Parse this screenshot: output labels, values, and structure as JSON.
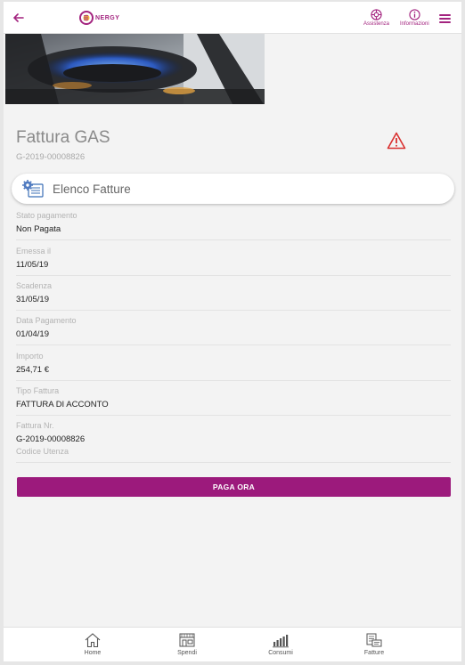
{
  "header": {
    "logo_text": "NERGY",
    "assistenza_label": "Assistenza",
    "informazioni_label": "Informazioni"
  },
  "invoice": {
    "title": "Fattura GAS",
    "code": "G-2019-00008826"
  },
  "elenco": {
    "label": "Elenco Fatture"
  },
  "fields": [
    {
      "label": "Stato pagamento",
      "value": "Non Pagata"
    },
    {
      "label": "Emessa il",
      "value": "11/05/19"
    },
    {
      "label": "Scadenza",
      "value": "31/05/19"
    },
    {
      "label": "Data Pagamento",
      "value": "01/04/19"
    },
    {
      "label": "Importo",
      "value": "254,71 €"
    },
    {
      "label": "Tipo Fattura",
      "value": "FATTURA DI ACCONTO"
    },
    {
      "label": "Fattura Nr.",
      "value": "G-2019-00008826"
    },
    {
      "label": "Codice Utenza",
      "value": ""
    }
  ],
  "pay_button": {
    "label": "PAGA ORA"
  },
  "bottom_nav": [
    {
      "label": "Home",
      "icon": "home-icon"
    },
    {
      "label": "Spendi",
      "icon": "shop-icon"
    },
    {
      "label": "Consumi",
      "icon": "bar-chart-icon"
    },
    {
      "label": "Fatture",
      "icon": "invoices-icon"
    }
  ],
  "colors": {
    "brand": "#9c1a7c",
    "accent": "#a3247f",
    "warning": "#d9302f"
  }
}
